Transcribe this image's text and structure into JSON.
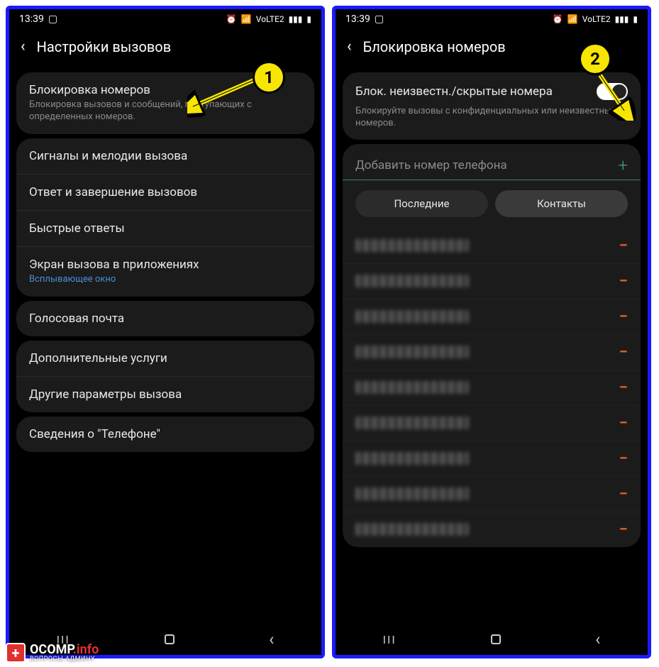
{
  "status": {
    "time": "13:39",
    "alarm": "⏰",
    "wifi": "📶",
    "lte": "VoLTE2",
    "signal": "▮▮▮",
    "batt": "▮"
  },
  "screen1": {
    "title": "Настройки вызовов",
    "g1": {
      "title": "Блокировка номеров",
      "sub": "Блокировка вызовов и сообщений, поступающих с определенных номеров."
    },
    "g2": {
      "i1": "Сигналы и мелодии вызова",
      "i2": "Ответ и завершение вызовов",
      "i3": "Быстрые ответы",
      "i4": "Экран вызова в приложениях",
      "i4s": "Всплывающее окно"
    },
    "g3": {
      "i1": "Голосовая почта"
    },
    "g4": {
      "i1": "Дополнительные услуги",
      "i2": "Другие параметры вызова"
    },
    "g5": {
      "i1": "Сведения о \"Телефоне\""
    }
  },
  "screen2": {
    "title": "Блокировка номеров",
    "toggle": {
      "title": "Блок. неизвестн./скрытые номера",
      "sub": "Блокируйте вызовы с конфиденциальных или неизвестных номеров."
    },
    "input_placeholder": "Добавить номер телефона",
    "btn_recent": "Последние",
    "btn_contacts": "Контакты",
    "rows": 9
  },
  "annotations": {
    "b1": "1",
    "b2": "2"
  },
  "watermark": {
    "site": "OCOMP",
    "tld": ".info",
    "sub": "ВОПРОСЫ АДМИНУ"
  },
  "icons": {
    "plus": "+",
    "minus": "−",
    "back": "‹",
    "nav_recent": "III",
    "nav_back": "‹"
  }
}
